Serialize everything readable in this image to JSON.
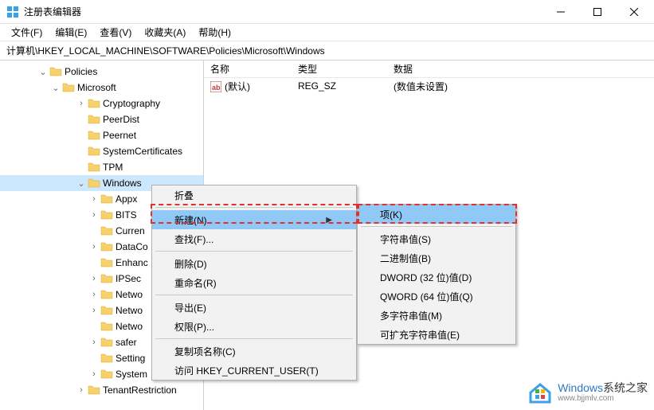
{
  "titlebar": {
    "title": "注册表编辑器"
  },
  "menubar": {
    "file": "文件(F)",
    "edit": "编辑(E)",
    "view": "查看(V)",
    "favorites": "收藏夹(A)",
    "help": "帮助(H)"
  },
  "address": "计算机\\HKEY_LOCAL_MACHINE\\SOFTWARE\\Policies\\Microsoft\\Windows",
  "tree": {
    "policies": "Policies",
    "microsoft": "Microsoft",
    "children": [
      "Cryptography",
      "PeerDist",
      "Peernet",
      "SystemCertificates",
      "TPM",
      "Windows"
    ],
    "windows_children": [
      "Appx",
      "BITS",
      "Curren",
      "DataCo",
      "Enhanc",
      "IPSec",
      "Netwo",
      "Netwo",
      "Netwo",
      "safer",
      "Setting",
      "System"
    ],
    "tenant": "TenantRestriction"
  },
  "list": {
    "cols": {
      "name": "名称",
      "type": "类型",
      "data": "数据"
    },
    "rows": [
      {
        "name": "(默认)",
        "type": "REG_SZ",
        "data": "(数值未设置)"
      }
    ]
  },
  "ctx1": {
    "collapse": "折叠",
    "new": "新建(N)",
    "find": "查找(F)...",
    "delete": "删除(D)",
    "rename": "重命名(R)",
    "export": "导出(E)",
    "permissions": "权限(P)...",
    "copy_key_name": "复制项名称(C)",
    "goto_hkcu": "访问 HKEY_CURRENT_USER(T)"
  },
  "ctx2": {
    "key": "项(K)",
    "string": "字符串值(S)",
    "binary": "二进制值(B)",
    "dword": "DWORD (32 位)值(D)",
    "qword": "QWORD (64 位)值(Q)",
    "multi": "多字符串值(M)",
    "expand": "可扩充字符串值(E)"
  },
  "watermark": {
    "brand": "Windows",
    "tagline": "系统之家",
    "url": "www.bjjmlv.com"
  }
}
